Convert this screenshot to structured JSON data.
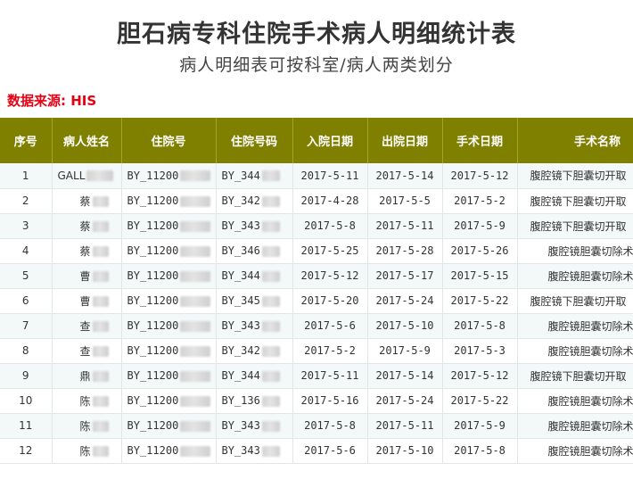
{
  "header": {
    "title": "胆石病专科住院手术病人明细统计表",
    "subtitle": "病人明细表可按科室/病人两类划分",
    "source": "数据来源: HIS"
  },
  "table": {
    "columns": [
      "序号",
      "病人姓名",
      "住院号",
      "住院号码",
      "入院日期",
      "出院日期",
      "手术日期",
      "手术名称"
    ],
    "rows": [
      {
        "idx": "1",
        "name": "GALL",
        "inpatient_no": "BY_11200",
        "inpatient_code": "BY_344",
        "admit": "2017-5-11",
        "discharge": "2017-5-14",
        "surgery_date": "2017-5-12",
        "surgery": "腹腔镜下胆囊切开取",
        "indent": false
      },
      {
        "idx": "2",
        "name": "蔡",
        "inpatient_no": "BY_11200",
        "inpatient_code": "BY_342",
        "admit": "2017-4-28",
        "discharge": "2017-5-5",
        "surgery_date": "2017-5-2",
        "surgery": "腹腔镜下胆囊切开取",
        "indent": false
      },
      {
        "idx": "3",
        "name": "蔡",
        "inpatient_no": "BY_11200",
        "inpatient_code": "BY_343",
        "admit": "2017-5-8",
        "discharge": "2017-5-11",
        "surgery_date": "2017-5-9",
        "surgery": "腹腔镜下胆囊切开取",
        "indent": false
      },
      {
        "idx": "4",
        "name": "蔡",
        "inpatient_no": "BY_11200",
        "inpatient_code": "BY_346",
        "admit": "2017-5-25",
        "discharge": "2017-5-28",
        "surgery_date": "2017-5-26",
        "surgery": "腹腔镜胆囊切除术",
        "indent": true
      },
      {
        "idx": "5",
        "name": "曹",
        "inpatient_no": "BY_11200",
        "inpatient_code": "BY_344",
        "admit": "2017-5-12",
        "discharge": "2017-5-17",
        "surgery_date": "2017-5-15",
        "surgery": "腹腔镜胆囊切除术",
        "indent": true
      },
      {
        "idx": "6",
        "name": "曹",
        "inpatient_no": "BY_11200",
        "inpatient_code": "BY_345",
        "admit": "2017-5-20",
        "discharge": "2017-5-24",
        "surgery_date": "2017-5-22",
        "surgery": "腹腔镜下胆囊切开取",
        "indent": false
      },
      {
        "idx": "7",
        "name": "查",
        "inpatient_no": "BY_11200",
        "inpatient_code": "BY_343",
        "admit": "2017-5-6",
        "discharge": "2017-5-10",
        "surgery_date": "2017-5-8",
        "surgery": "腹腔镜胆囊切除术",
        "indent": true
      },
      {
        "idx": "8",
        "name": "查",
        "inpatient_no": "BY_11200",
        "inpatient_code": "BY_342",
        "admit": "2017-5-2",
        "discharge": "2017-5-9",
        "surgery_date": "2017-5-3",
        "surgery": "腹腔镜胆囊切除术",
        "indent": true
      },
      {
        "idx": "9",
        "name": "鼎",
        "inpatient_no": "BY_11200",
        "inpatient_code": "BY_344",
        "admit": "2017-5-11",
        "discharge": "2017-5-14",
        "surgery_date": "2017-5-12",
        "surgery": "腹腔镜下胆囊切开取",
        "indent": false
      },
      {
        "idx": "10",
        "name": "陈",
        "inpatient_no": "BY_11200",
        "inpatient_code": "BY_136",
        "admit": "2017-5-16",
        "discharge": "2017-5-24",
        "surgery_date": "2017-5-22",
        "surgery": "腹腔镜胆囊切除术",
        "indent": true
      },
      {
        "idx": "11",
        "name": "陈",
        "inpatient_no": "BY_11200",
        "inpatient_code": "BY_343",
        "admit": "2017-5-8",
        "discharge": "2017-5-11",
        "surgery_date": "2017-5-9",
        "surgery": "腹腔镜胆囊切除术",
        "indent": true
      },
      {
        "idx": "12",
        "name": "陈",
        "inpatient_no": "BY_11200",
        "inpatient_code": "BY_343",
        "admit": "2017-5-6",
        "discharge": "2017-5-10",
        "surgery_date": "2017-5-8",
        "surgery": "腹腔镜胆囊切除术",
        "indent": true
      }
    ]
  },
  "colors": {
    "header_bg": "#808000",
    "header_text": "#ffffff",
    "source_text": "#e60012",
    "row_alt": "#f3f8f8"
  }
}
